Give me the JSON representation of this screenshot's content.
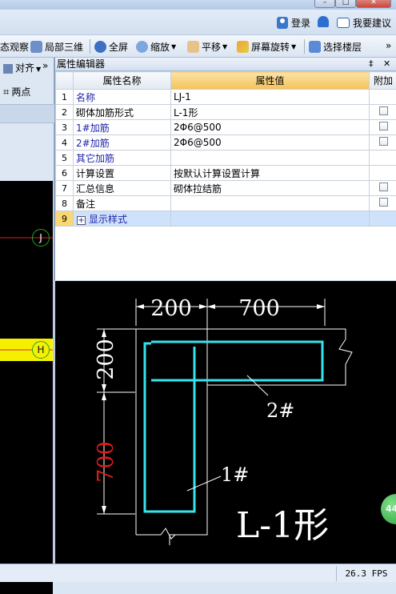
{
  "topbar": {
    "login_label": "登录",
    "suggest_label": "我要建议",
    "window_min": "–",
    "window_max": "□",
    "window_close": "✕"
  },
  "toolbar": {
    "dynamic_view": "态观察",
    "local_3d": "局部三维",
    "fullscreen": "全屏",
    "zoom": "缩放",
    "pan": "平移",
    "rotate_screen": "屏幕旋转",
    "select_floor": "选择楼层",
    "overflow": "»"
  },
  "left_panel": {
    "align": "对齐",
    "two_points": "两点",
    "overflow": "»",
    "overflow_bottom": "»",
    "axis_labels": [
      "J",
      "H"
    ]
  },
  "property_editor": {
    "title": "属性编辑器",
    "pin": "‡",
    "close": "✕",
    "col_name": "属性名称",
    "col_value": "属性值",
    "col_extra": "附加",
    "rows": [
      {
        "num": "1",
        "name": "名称",
        "value": "LJ-1",
        "blue": true,
        "check": false
      },
      {
        "num": "2",
        "name": "砌体加筋形式",
        "value": "L-1形",
        "blue": false,
        "check": true
      },
      {
        "num": "3",
        "name": "1#加筋",
        "value": "2Φ6@500",
        "blue": true,
        "check": true
      },
      {
        "num": "4",
        "name": "2#加筋",
        "value": "2Φ6@500",
        "blue": true,
        "check": true
      },
      {
        "num": "5",
        "name": "其它加筋",
        "value": "",
        "blue": true,
        "check": false
      },
      {
        "num": "6",
        "name": "计算设置",
        "value": "按默认计算设置计算",
        "blue": false,
        "check": false
      },
      {
        "num": "7",
        "name": "汇总信息",
        "value": "砌体拉结筋",
        "blue": false,
        "check": true
      },
      {
        "num": "8",
        "name": "备注",
        "value": "",
        "blue": false,
        "check": true
      },
      {
        "num": "9",
        "name": "显示样式",
        "value": "",
        "blue": true,
        "check": false,
        "expand": true
      }
    ]
  },
  "drawing": {
    "dim_top_left": "200",
    "dim_top_right": "700",
    "dim_left_top": "200",
    "dim_left_bottom": "700",
    "label_2": "2#",
    "label_1": "1#",
    "shape_title": "L-1形",
    "colors": {
      "rebar": "#33e5ee",
      "dim": "#ffffff",
      "dim_red": "#e01b1b"
    }
  },
  "status": {
    "fps": "26.3 FPS",
    "badge": "44"
  }
}
